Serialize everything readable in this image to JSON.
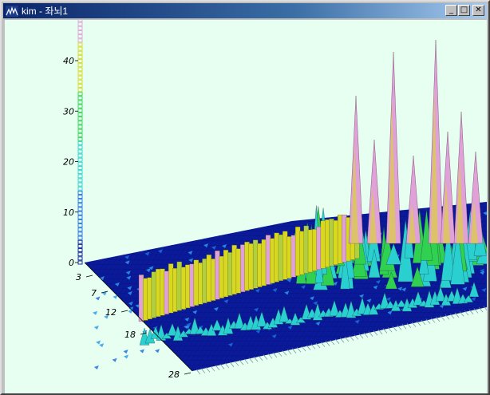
{
  "window": {
    "title": "kim - 좌뇌1",
    "controls": {
      "minimize": "_",
      "maximize": "□",
      "close": "✕"
    }
  },
  "plot": {
    "z_axis_ticks": [
      "0",
      "10",
      "20",
      "30",
      "40"
    ],
    "y_axis_ticks": [
      "3",
      "7",
      "12",
      "18",
      "28"
    ]
  },
  "chart_data": {
    "type": "surface",
    "z_range": [
      0,
      48
    ],
    "z_ticks": [
      0,
      10,
      20,
      30,
      40
    ],
    "y_ticks": [
      3,
      7,
      12,
      18,
      28
    ],
    "colors": {
      "background": "#e6fff0",
      "low": "#0a1a9a",
      "mid_low": "#1e6fe0",
      "mid": "#2ad0d0",
      "mid_high": "#30d050",
      "high": "#d8d820",
      "top": "#e0a0d8"
    }
  }
}
